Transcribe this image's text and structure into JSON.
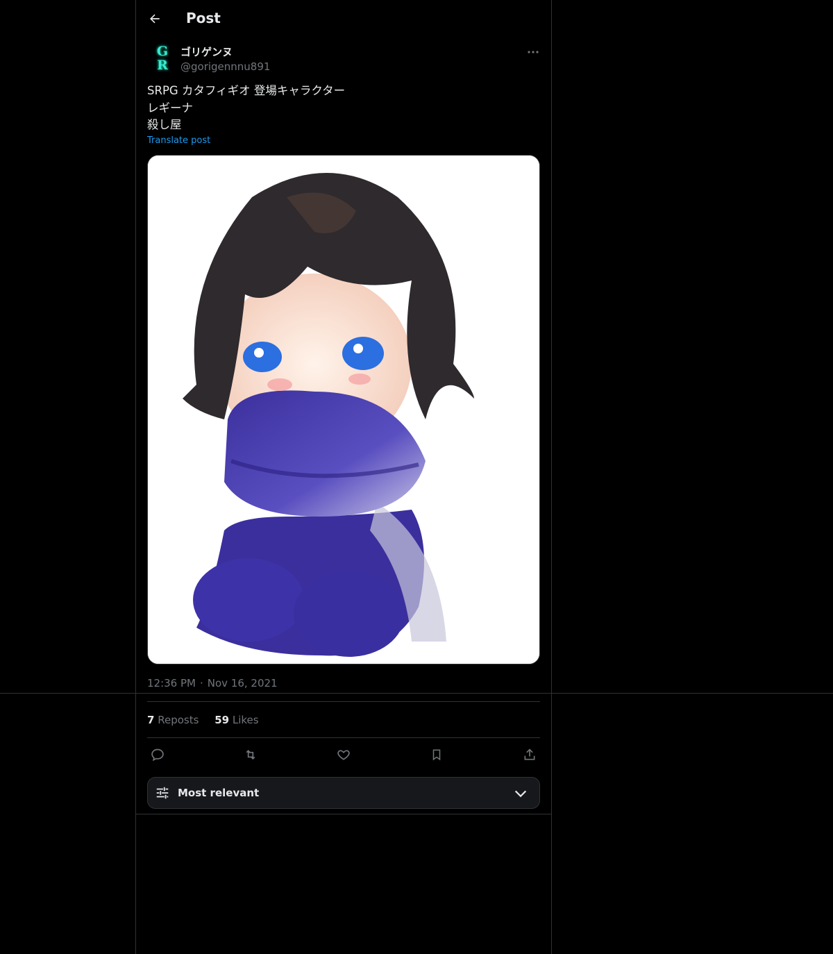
{
  "header": {
    "title": "Post",
    "back_icon": "arrow-left-icon"
  },
  "author": {
    "display_name": "ゴリゲンヌ",
    "handle": "@gorigennnu891",
    "avatar_letters": [
      "G",
      "R"
    ]
  },
  "post": {
    "lines": [
      "SRPG カタフィギオ 登場キャラクター",
      "レギーナ",
      "殺し屋"
    ],
    "translate_label": "Translate post",
    "media_description": "anime-style-girl-illustration",
    "time": "12:36 PM",
    "date": "Nov 16, 2021",
    "separator": "·"
  },
  "stats": {
    "reposts_count": "7",
    "reposts_label": "Reposts",
    "likes_count": "59",
    "likes_label": "Likes"
  },
  "actions": [
    "reply-icon",
    "repost-icon",
    "like-icon",
    "bookmark-icon",
    "share-icon"
  ],
  "sort": {
    "label": "Most relevant"
  },
  "colors": {
    "background": "#000000",
    "text": "#e7e9ea",
    "muted": "#71767b",
    "link": "#1d9bf0",
    "border": "#2f3336"
  }
}
